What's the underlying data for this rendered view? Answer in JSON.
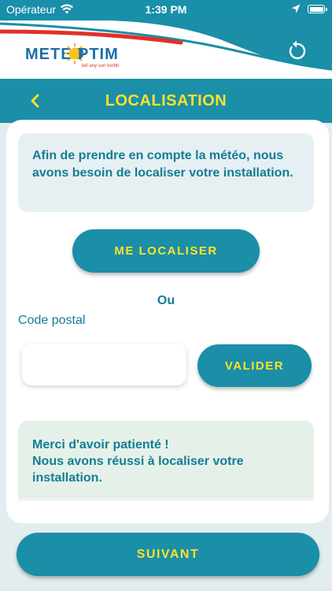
{
  "status_bar": {
    "carrier": "Opérateur",
    "time": "1:39 PM",
    "wifi_icon": "wifi-icon",
    "location_icon": "location-arrow-icon",
    "battery_icon": "battery-icon"
  },
  "header": {
    "logo": {
      "text_left": "METEO",
      "text_right": "PTIM",
      "tagline": "tell any sun herbit"
    },
    "refresh_icon": "refresh-icon"
  },
  "nav": {
    "back_icon": "chevron-left-icon",
    "title": "LOCALISATION"
  },
  "main": {
    "info_text": "Afin de prendre en compte la météo, nous avons besoin de localiser votre installation.",
    "locate_button": "ME LOCALISER",
    "or_text": "Ou",
    "postal_label": "Code postal",
    "postal_value": "",
    "postal_placeholder": "",
    "validate_button": "VALIDER",
    "success_line1": "Merci d'avoir patienté !",
    "success_line2": "Nous avons réussi à localiser votre installation."
  },
  "footer": {
    "next_button": "SUIVANT"
  },
  "colors": {
    "primary": "#1b8ea8",
    "accent_yellow": "#ffe229",
    "text_teal": "#137d95",
    "info_bg": "#e6f0f3",
    "success_bg": "#e5f1e8",
    "page_bg": "#e3ecef"
  }
}
